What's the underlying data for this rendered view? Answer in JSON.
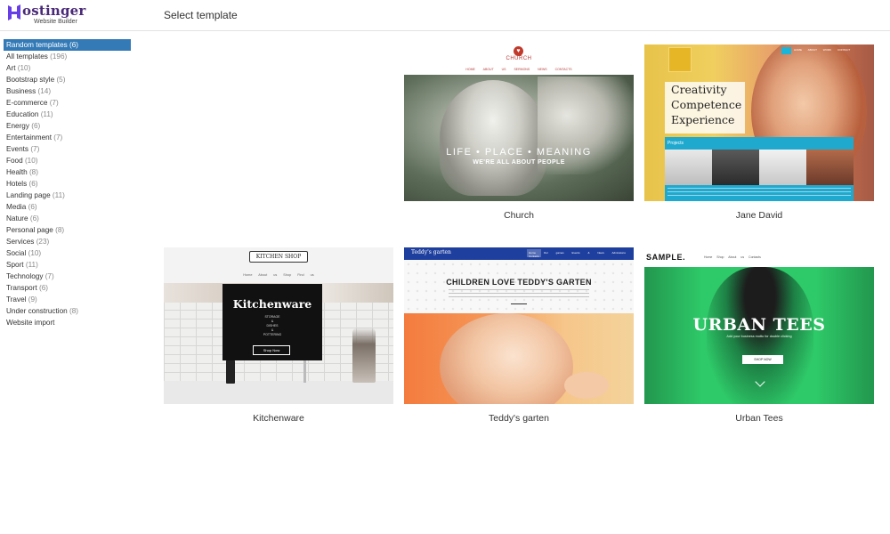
{
  "brand": {
    "name": "Hostinger",
    "name_rest": "ostinger",
    "subtitle": "Website Builder",
    "color": "#4a2a78"
  },
  "header": {
    "title": "Select template"
  },
  "sidebar": {
    "active_color": "#337ab7",
    "categories": [
      {
        "label": "Random templates",
        "count": "(6)",
        "active": true
      },
      {
        "label": "All templates",
        "count": "(196)"
      },
      {
        "label": "Art",
        "count": "(10)"
      },
      {
        "label": "Bootstrap style",
        "count": "(5)"
      },
      {
        "label": "Business",
        "count": "(14)"
      },
      {
        "label": "E-commerce",
        "count": "(7)"
      },
      {
        "label": "Education",
        "count": "(11)"
      },
      {
        "label": "Energy",
        "count": "(6)"
      },
      {
        "label": "Entertainment",
        "count": "(7)"
      },
      {
        "label": "Events",
        "count": "(7)"
      },
      {
        "label": "Food",
        "count": "(10)"
      },
      {
        "label": "Health",
        "count": "(8)"
      },
      {
        "label": "Hotels",
        "count": "(6)"
      },
      {
        "label": "Landing page",
        "count": "(11)"
      },
      {
        "label": "Media",
        "count": "(6)"
      },
      {
        "label": "Nature",
        "count": "(6)"
      },
      {
        "label": "Personal page",
        "count": "(8)"
      },
      {
        "label": "Services",
        "count": "(23)"
      },
      {
        "label": "Social",
        "count": "(10)"
      },
      {
        "label": "Sport",
        "count": "(11)"
      },
      {
        "label": "Technology",
        "count": "(7)"
      },
      {
        "label": "Transport",
        "count": "(6)"
      },
      {
        "label": "Travel",
        "count": "(9)"
      },
      {
        "label": "Under construction",
        "count": "(8)"
      },
      {
        "label": "Website import",
        "count": ""
      }
    ]
  },
  "templates": [
    {
      "name": "Church",
      "preview": {
        "site_name": "CHURCH",
        "nav": "HOME ABOUT US SERMONS NEWS CONTACTS",
        "tagline": "LIFE  •  PLACE  •  MEANING",
        "subline": "WE'RE ALL ABOUT PEOPLE"
      }
    },
    {
      "name": "Jane David",
      "preview": {
        "nav": "HOME ABOUT WORK CONTACT",
        "panel_lines": [
          "Creativity",
          "Competence",
          "Experience"
        ],
        "section": "Projects"
      }
    },
    {
      "name": "Kitchenware",
      "preview": {
        "logo": "KITCHEN SHOP",
        "nav": "Home About us Shop Find us",
        "title": "Kitchenware",
        "sub_lines": [
          "STORAGE",
          "&",
          "DISHES",
          "&",
          "POTTERING"
        ],
        "button": "Shop Now"
      }
    },
    {
      "name": "Teddy's garten",
      "preview": {
        "logo": "Teddy's garten",
        "nav": "Home Our games Events & News Admissions Contacts",
        "title": "CHILDREN LOVE TEDDY'S GARTEN"
      }
    },
    {
      "name": "Urban Tees",
      "preview": {
        "logo": "SAMPLE.",
        "nav": "Home Shop About us Contacts",
        "title": "URBAN TEES",
        "sub": "Add your business motto for double clicking",
        "button": "SHOP NOW",
        "accent": "#2ec968"
      }
    }
  ]
}
